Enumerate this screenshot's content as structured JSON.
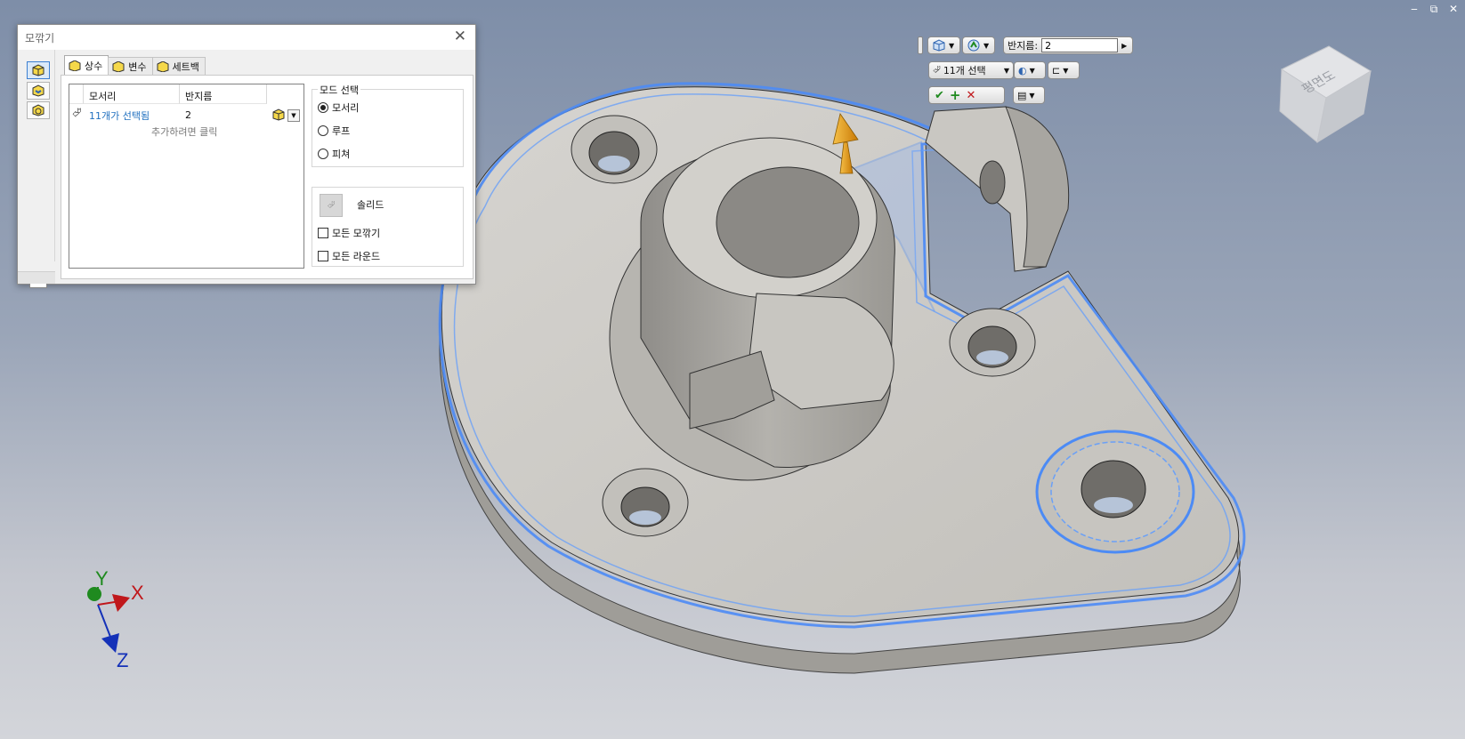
{
  "window": {
    "minimize": "‒",
    "restore": "⧉",
    "close": "✕"
  },
  "dialog": {
    "title": "모깎기",
    "close_label": "✕",
    "help_label": "?",
    "tabs": [
      {
        "label": "상수"
      },
      {
        "label": "변수"
      },
      {
        "label": "세트백"
      }
    ],
    "grid": {
      "col_edges": "모서리",
      "col_radius": "반지름",
      "row_selection": "11개가 선택됨",
      "row_radius": "2",
      "add_hint": "추가하려면 클릭"
    },
    "mode": {
      "label": "모드 선택",
      "options": [
        "모서리",
        "루프",
        "피쳐"
      ],
      "selected": "모서리"
    },
    "solid_label": "솔리드",
    "all_fillets_label": "모든 모깎기",
    "all_rounds_label": "모든 라운드"
  },
  "mini_toolbar": {
    "radius_label": "반지름:",
    "radius_value": "2",
    "selection_label": "11개 선택"
  },
  "viewcube": {
    "face_label": "평면도"
  },
  "axes": {
    "x": "X",
    "y": "Y",
    "z": "Z"
  },
  "colors": {
    "selection_highlight": "#4c8bf5",
    "axis_x": "#c0171b",
    "axis_y": "#1f8a1f",
    "axis_z": "#1431b8",
    "drag_arrow": "#e29a12"
  }
}
